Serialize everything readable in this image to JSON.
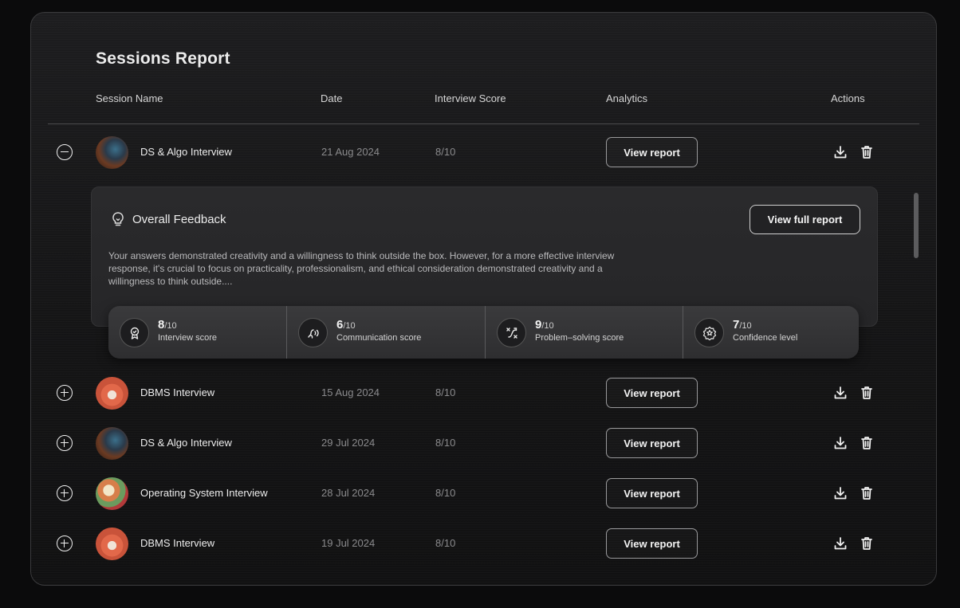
{
  "title": "Sessions Report",
  "columns": {
    "session_name": "Session Name",
    "date": "Date",
    "score": "Interview Score",
    "analytics": "Analytics",
    "actions": "Actions"
  },
  "view_report_label": "View report",
  "sessions": [
    {
      "name": "DS & Algo Interview",
      "date": "21 Aug 2024",
      "score": "8/10",
      "expanded": true
    },
    {
      "name": "DBMS Interview",
      "date": "15 Aug 2024",
      "score": "8/10",
      "expanded": false
    },
    {
      "name": "DS & Algo Interview",
      "date": "29 Jul 2024",
      "score": "8/10",
      "expanded": false
    },
    {
      "name": "Operating System Interview",
      "date": "28 Jul 2024",
      "score": "8/10",
      "expanded": false
    },
    {
      "name": "DBMS Interview",
      "date": "19 Jul 2024",
      "score": "8/10",
      "expanded": false
    }
  ],
  "feedback": {
    "title": "Overall Feedback",
    "full_report_label": "View full report",
    "text": "Your answers demonstrated creativity and a willingness to think outside the box. However, for a more effective interview response, it's crucial to focus on practicality, professionalism, and ethical consideration demonstrated creativity and a willingness to think outside....",
    "stats": [
      {
        "value": "8",
        "denominator": "/10",
        "label": "Interview score",
        "icon": "badge-check-icon"
      },
      {
        "value": "6",
        "denominator": "/10",
        "label": "Communication score",
        "icon": "speaking-head-icon"
      },
      {
        "value": "9",
        "denominator": "/10",
        "label": "Problem–solving score",
        "icon": "strategy-icon"
      },
      {
        "value": "7",
        "denominator": "/10",
        "label": "Confidence level",
        "icon": "star-badge-icon"
      }
    ]
  }
}
